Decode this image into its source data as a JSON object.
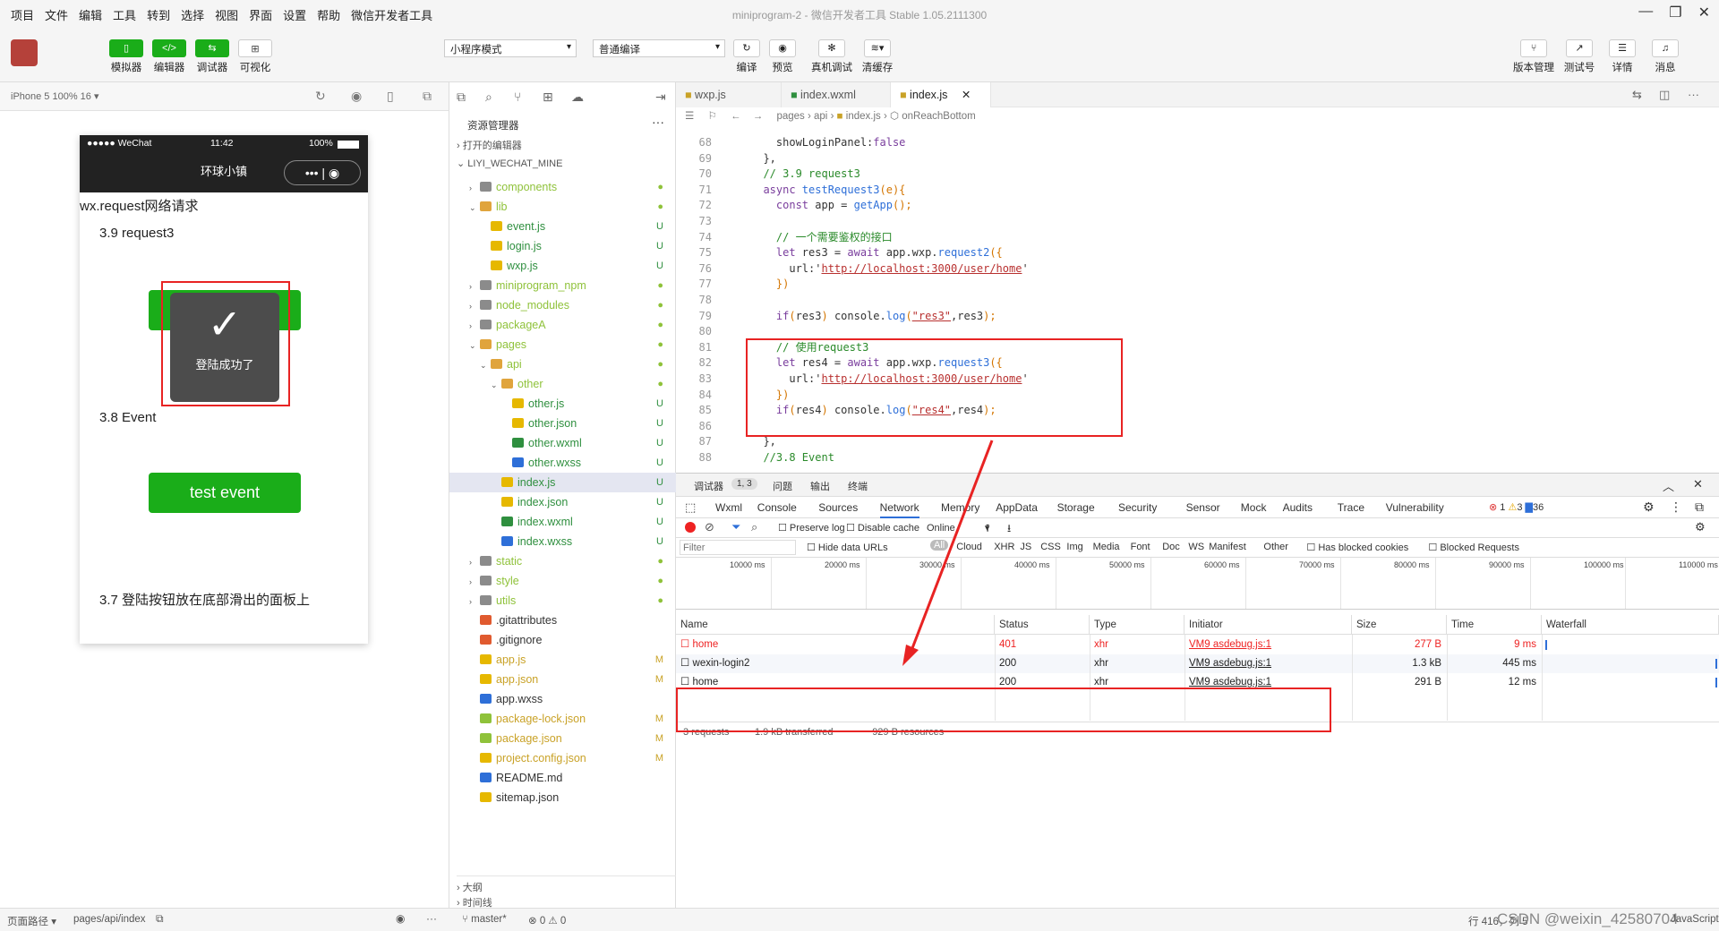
{
  "menubar": {
    "items": [
      "项目",
      "文件",
      "编辑",
      "工具",
      "转到",
      "选择",
      "视图",
      "界面",
      "设置",
      "帮助",
      "微信开发者工具"
    ],
    "window_title": "miniprogram-2 - 微信开发者工具 Stable 1.05.2111300"
  },
  "toolbar": {
    "left_buttons": [
      "模拟器",
      "编辑器",
      "调试器",
      "可视化"
    ],
    "mode_select": "小程序模式",
    "compile_select": "普通编译",
    "mid_buttons": [
      "编译",
      "预览",
      "真机调试",
      "清缓存"
    ],
    "right_buttons": [
      "版本管理",
      "测试号",
      "详情",
      "消息"
    ]
  },
  "simulator": {
    "device": "iPhone 5 100% 16 ▾",
    "status_left": "●●●●● WeChat",
    "status_time": "11:42",
    "status_battery": "100%",
    "nav_title": "环球小镇",
    "page_title": "wx.request网络请求",
    "section1": "3.9 request3",
    "toast_text": "登陆成功了",
    "section2": "3.8 Event",
    "event_button": "test event",
    "section3": "3.7 登陆按钮放在底部滑出的面板上"
  },
  "explorer": {
    "title": "资源管理器",
    "open_editors": "打开的编辑器",
    "project": "LIYI_WECHAT_MINE",
    "outline": "大纲",
    "timeline": "时间线",
    "tree": [
      {
        "name": "components",
        "depth": 1,
        "type": "folder",
        "status": "●",
        "color": "#8fc23a"
      },
      {
        "name": "lib",
        "depth": 1,
        "type": "folder-open",
        "status": "●",
        "color": "#8fc23a"
      },
      {
        "name": "event.js",
        "depth": 2,
        "type": "js",
        "status": "U",
        "color": "#2f8f3f"
      },
      {
        "name": "login.js",
        "depth": 2,
        "type": "js",
        "status": "U",
        "color": "#2f8f3f"
      },
      {
        "name": "wxp.js",
        "depth": 2,
        "type": "js",
        "status": "U",
        "color": "#2f8f3f"
      },
      {
        "name": "miniprogram_npm",
        "depth": 1,
        "type": "folder",
        "status": "●",
        "color": "#8fc23a"
      },
      {
        "name": "node_modules",
        "depth": 1,
        "type": "folder",
        "status": "●",
        "color": "#8fc23a"
      },
      {
        "name": "packageA",
        "depth": 1,
        "type": "folder",
        "status": "●",
        "color": "#8fc23a"
      },
      {
        "name": "pages",
        "depth": 1,
        "type": "folder-open",
        "status": "●",
        "color": "#8fc23a"
      },
      {
        "name": "api",
        "depth": 2,
        "type": "folder-open",
        "status": "●",
        "color": "#8fc23a"
      },
      {
        "name": "other",
        "depth": 3,
        "type": "folder-open",
        "status": "●",
        "color": "#8fc23a"
      },
      {
        "name": "other.js",
        "depth": 4,
        "type": "js",
        "status": "U",
        "color": "#2f8f3f"
      },
      {
        "name": "other.json",
        "depth": 4,
        "type": "json",
        "status": "U",
        "color": "#2f8f3f"
      },
      {
        "name": "other.wxml",
        "depth": 4,
        "type": "wxml",
        "status": "U",
        "color": "#2f8f3f"
      },
      {
        "name": "other.wxss",
        "depth": 4,
        "type": "wxss",
        "status": "U",
        "color": "#2f8f3f"
      },
      {
        "name": "index.js",
        "depth": 3,
        "type": "js",
        "status": "U",
        "color": "#2f8f3f",
        "selected": true
      },
      {
        "name": "index.json",
        "depth": 3,
        "type": "json",
        "status": "U",
        "color": "#2f8f3f"
      },
      {
        "name": "index.wxml",
        "depth": 3,
        "type": "wxml",
        "status": "U",
        "color": "#2f8f3f"
      },
      {
        "name": "index.wxss",
        "depth": 3,
        "type": "wxss",
        "status": "U",
        "color": "#2f8f3f"
      },
      {
        "name": "static",
        "depth": 1,
        "type": "folder",
        "status": "●",
        "color": "#8fc23a"
      },
      {
        "name": "style",
        "depth": 1,
        "type": "folder",
        "status": "●",
        "color": "#8fc23a"
      },
      {
        "name": "utils",
        "depth": 1,
        "type": "folder",
        "status": "●",
        "color": "#8fc23a"
      },
      {
        "name": ".gitattributes",
        "depth": 1,
        "type": "git",
        "status": "",
        "color": "#333"
      },
      {
        "name": ".gitignore",
        "depth": 1,
        "type": "git",
        "status": "",
        "color": "#333"
      },
      {
        "name": "app.js",
        "depth": 1,
        "type": "js",
        "status": "M",
        "color": "#c9a227"
      },
      {
        "name": "app.json",
        "depth": 1,
        "type": "json",
        "status": "M",
        "color": "#c9a227"
      },
      {
        "name": "app.wxss",
        "depth": 1,
        "type": "wxss",
        "status": "",
        "color": "#333"
      },
      {
        "name": "package-lock.json",
        "depth": 1,
        "type": "pkg",
        "status": "M",
        "color": "#c9a227"
      },
      {
        "name": "package.json",
        "depth": 1,
        "type": "pkg",
        "status": "M",
        "color": "#c9a227"
      },
      {
        "name": "project.config.json",
        "depth": 1,
        "type": "json",
        "status": "M",
        "color": "#c9a227"
      },
      {
        "name": "README.md",
        "depth": 1,
        "type": "info",
        "status": "",
        "color": "#333"
      },
      {
        "name": "sitemap.json",
        "depth": 1,
        "type": "json",
        "status": "",
        "color": "#333"
      }
    ]
  },
  "editor": {
    "tabs": [
      "wxp.js",
      "index.wxml",
      "index.js"
    ],
    "breadcrumb": [
      "pages",
      "api",
      "index.js",
      "onReachBottom"
    ],
    "lines": [
      {
        "n": "68",
        "tokens": [
          [
            "pl",
            "    showLoginPanel:"
          ],
          [
            "kw",
            "false"
          ]
        ]
      },
      {
        "n": "69",
        "tokens": [
          [
            "pl",
            "  },"
          ]
        ]
      },
      {
        "n": "70",
        "tokens": [
          [
            "cm",
            "  // 3.9 request3"
          ]
        ]
      },
      {
        "n": "71",
        "tokens": [
          [
            "kw",
            "  async "
          ],
          [
            "fn",
            "testRequest3"
          ],
          [
            "ol",
            "(e){"
          ]
        ]
      },
      {
        "n": "72",
        "tokens": [
          [
            "kw",
            "    const "
          ],
          [
            "pl",
            "app = "
          ],
          [
            "fn",
            "getApp"
          ],
          [
            "ol",
            "();"
          ]
        ]
      },
      {
        "n": "73",
        "tokens": [
          [
            "pl",
            ""
          ]
        ]
      },
      {
        "n": "74",
        "tokens": [
          [
            "cm",
            "    // 一个需要鉴权的接口"
          ]
        ]
      },
      {
        "n": "75",
        "tokens": [
          [
            "kw",
            "    let "
          ],
          [
            "pl",
            "res3 = "
          ],
          [
            "kw",
            "await "
          ],
          [
            "pl",
            "app.wxp."
          ],
          [
            "fn",
            "request2"
          ],
          [
            "ol",
            "({"
          ]
        ]
      },
      {
        "n": "76",
        "tokens": [
          [
            "pl",
            "      url:'"
          ],
          [
            "str",
            "http://localhost:3000/user/home"
          ],
          [
            "pl",
            "'"
          ]
        ]
      },
      {
        "n": "77",
        "tokens": [
          [
            "ol",
            "    })"
          ]
        ]
      },
      {
        "n": "78",
        "tokens": [
          [
            "pl",
            ""
          ]
        ]
      },
      {
        "n": "79",
        "tokens": [
          [
            "kw",
            "    if"
          ],
          [
            "ol",
            "("
          ],
          [
            "pl",
            "res3"
          ],
          [
            "ol",
            ") "
          ],
          [
            "pl",
            "console."
          ],
          [
            "fn",
            "log"
          ],
          [
            "ol",
            "("
          ],
          [
            "str",
            "\"res3\""
          ],
          [
            "pl",
            ",res3"
          ],
          [
            "ol",
            ");"
          ]
        ]
      },
      {
        "n": "80",
        "tokens": [
          [
            "pl",
            ""
          ]
        ]
      },
      {
        "n": "81",
        "tokens": [
          [
            "cm",
            "    // 使用request3"
          ]
        ]
      },
      {
        "n": "82",
        "tokens": [
          [
            "kw",
            "    let "
          ],
          [
            "pl",
            "res4 = "
          ],
          [
            "kw",
            "await "
          ],
          [
            "pl",
            "app.wxp."
          ],
          [
            "fn",
            "request3"
          ],
          [
            "ol",
            "({"
          ]
        ]
      },
      {
        "n": "83",
        "tokens": [
          [
            "pl",
            "      url:'"
          ],
          [
            "str",
            "http://localhost:3000/user/home"
          ],
          [
            "pl",
            "'"
          ]
        ]
      },
      {
        "n": "84",
        "tokens": [
          [
            "ol",
            "    })"
          ]
        ]
      },
      {
        "n": "85",
        "tokens": [
          [
            "kw",
            "    if"
          ],
          [
            "ol",
            "("
          ],
          [
            "pl",
            "res4"
          ],
          [
            "ol",
            ") "
          ],
          [
            "pl",
            "console."
          ],
          [
            "fn",
            "log"
          ],
          [
            "ol",
            "("
          ],
          [
            "str",
            "\"res4\""
          ],
          [
            "pl",
            ",res4"
          ],
          [
            "ol",
            ");"
          ]
        ]
      },
      {
        "n": "86",
        "tokens": [
          [
            "pl",
            ""
          ]
        ]
      },
      {
        "n": "87",
        "tokens": [
          [
            "pl",
            "  },"
          ]
        ]
      },
      {
        "n": "88",
        "tokens": [
          [
            "cm",
            "  //3.8 Event"
          ]
        ]
      }
    ]
  },
  "devtools": {
    "top_tabs": [
      "调试器",
      "1, 3",
      "问题",
      "输出",
      "终端"
    ],
    "panel_tabs": [
      "Wxml",
      "Console",
      "Sources",
      "Network",
      "Memory",
      "AppData",
      "Storage",
      "Security",
      "Sensor",
      "Mock",
      "Audits",
      "Trace",
      "Vulnerability"
    ],
    "counts": {
      "errors": "1",
      "warnings": "3",
      "info": "36"
    },
    "preserve_log": "Preserve log",
    "disable_cache": "Disable cache",
    "throttle": "Online",
    "filter_placeholder": "Filter",
    "hide_data_urls": "Hide data URLs",
    "type_filters": [
      "All",
      "Cloud",
      "XHR",
      "JS",
      "CSS",
      "Img",
      "Media",
      "Font",
      "Doc",
      "WS",
      "Manifest",
      "Other"
    ],
    "blocked_cookies": "Has blocked cookies",
    "blocked_requests": "Blocked Requests",
    "timeline_ticks": [
      "10000 ms",
      "20000 ms",
      "30000 ms",
      "40000 ms",
      "50000 ms",
      "60000 ms",
      "70000 ms",
      "80000 ms",
      "90000 ms",
      "100000 ms",
      "110000 ms"
    ],
    "columns": [
      "Name",
      "Status",
      "Type",
      "Initiator",
      "Size",
      "Time",
      "Waterfall"
    ],
    "rows": [
      {
        "name": "home",
        "status": "401",
        "type": "xhr",
        "initiator": "VM9 asdebug.js:1",
        "size": "277 B",
        "time": "9 ms",
        "error": true
      },
      {
        "name": "wexin-login2",
        "status": "200",
        "type": "xhr",
        "initiator": "VM9 asdebug.js:1",
        "size": "1.3 kB",
        "time": "445 ms",
        "error": false
      },
      {
        "name": "home",
        "status": "200",
        "type": "xhr",
        "initiator": "VM9 asdebug.js:1",
        "size": "291 B",
        "time": "12 ms",
        "error": false
      }
    ],
    "summary": [
      "3 requests",
      "1.9 kB transferred",
      "929 B resources"
    ]
  },
  "statusbar": {
    "page_path_label": "页面路径 ▾",
    "page_path": "pages/api/index",
    "branch": "master*",
    "problems": "⊗ 0 ⚠ 0",
    "position": "行 416，列 5",
    "watermark": "CSDN @weixin_42580704",
    "lang": "JavaScript"
  }
}
